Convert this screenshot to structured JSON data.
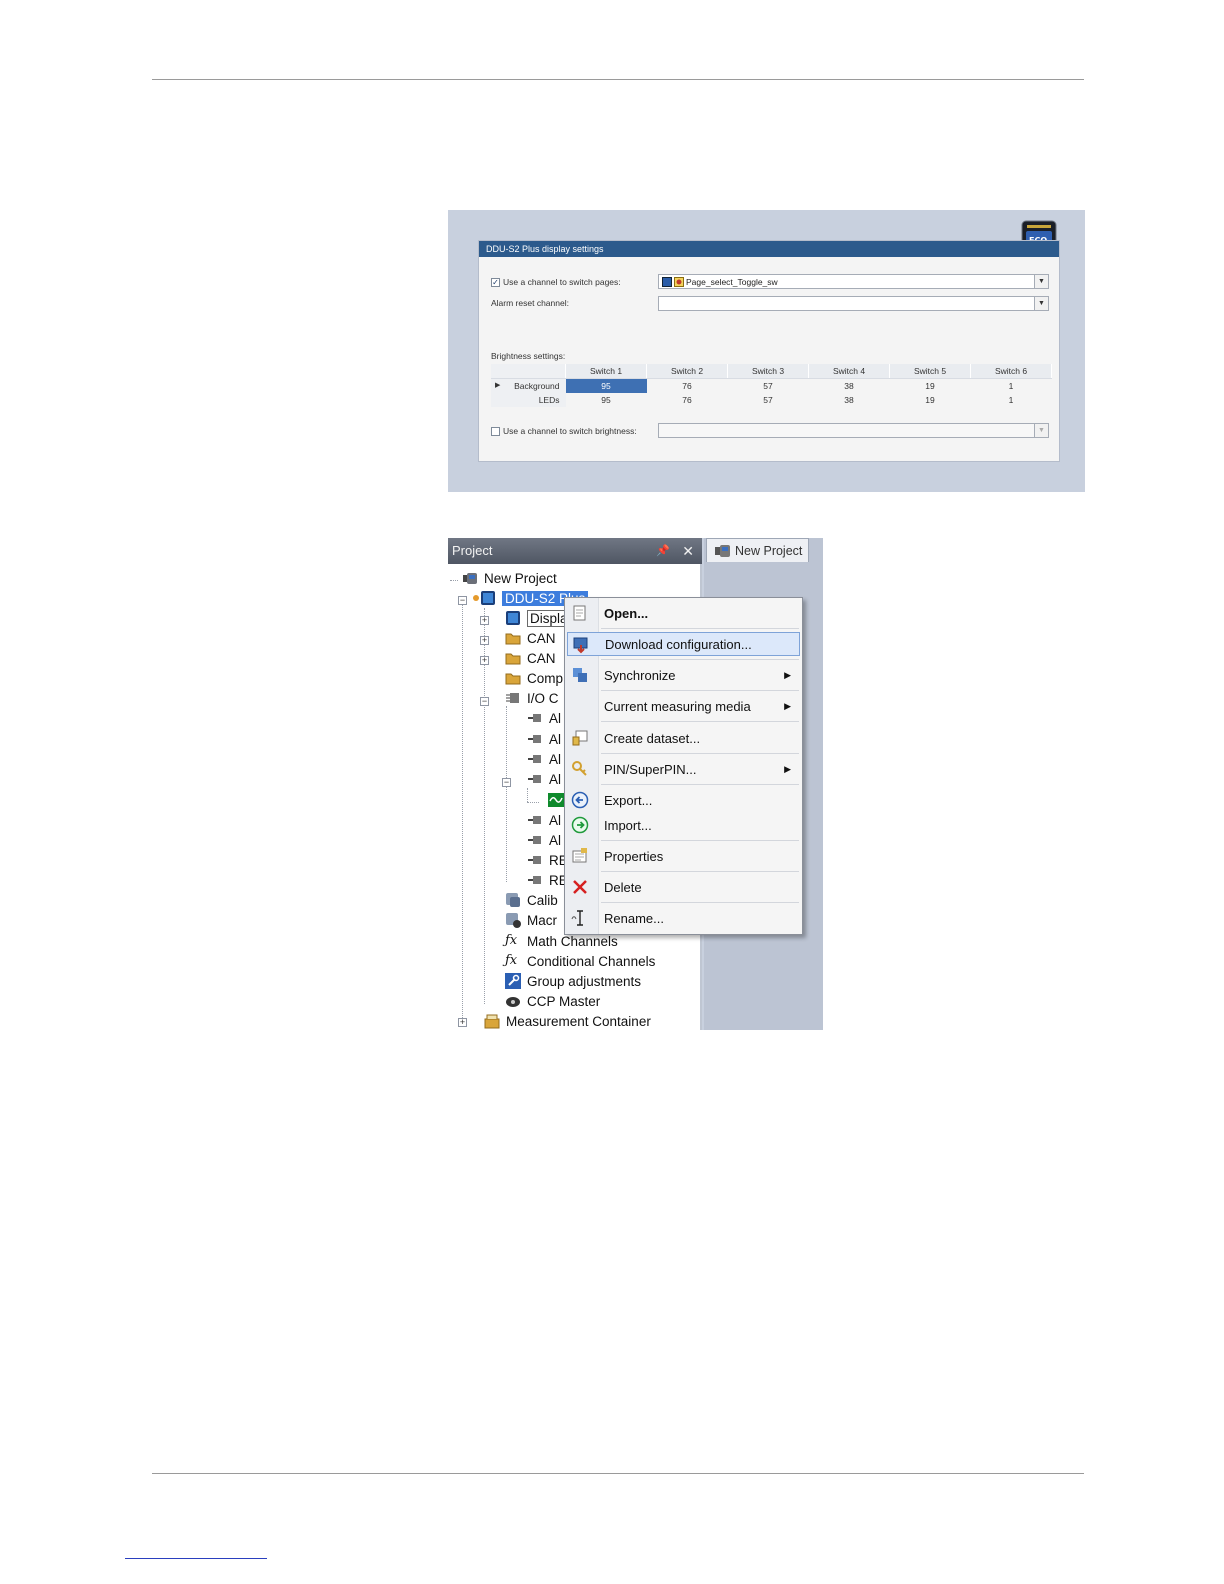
{
  "display_settings": {
    "panel_title": "DDU-S2 Plus display settings",
    "device_icon_text": "ECO",
    "switch_pages_label": "Use a channel to switch pages:",
    "switch_pages_checked": true,
    "switch_pages_value": "Page_select_Toggle_sw",
    "alarm_reset_label": "Alarm reset channel:",
    "alarm_reset_value": "",
    "brightness_label": "Brightness settings:",
    "columns": [
      "Switch 1",
      "Switch 2",
      "Switch 3",
      "Switch 4",
      "Switch 5",
      "Switch 6"
    ],
    "rows": [
      {
        "name": "Background",
        "values": [
          "95",
          "76",
          "57",
          "38",
          "19",
          "1"
        ]
      },
      {
        "name": "LEDs",
        "values": [
          "95",
          "76",
          "57",
          "38",
          "19",
          "1"
        ]
      }
    ],
    "switch_brightness_label": "Use a channel to switch brightness:",
    "switch_brightness_checked": false,
    "switch_brightness_value": ""
  },
  "project_panel": {
    "title": "Project",
    "tab_label": "New Project",
    "root": "New Project",
    "device": "DDU-S2 Plus",
    "items": {
      "display": "Displa",
      "can1": "CAN",
      "can2": "CAN",
      "comp": "Comp",
      "io": "I/O C",
      "a1": "Al",
      "a2": "Al",
      "a3": "Al",
      "a4": "Al",
      "a5": "Al",
      "a6": "Al",
      "r1": "RE",
      "r2": "RE",
      "calib": "Calib",
      "macro": "Macr",
      "math": "Math Channels",
      "cond": "Conditional Channels",
      "group": "Group adjustments",
      "ccp": "CCP Master",
      "measure": "Measurement Container"
    }
  },
  "context_menu": {
    "open": "Open...",
    "download": "Download configuration...",
    "synchronize": "Synchronize",
    "current_media": "Current measuring media",
    "create_dataset": "Create dataset...",
    "pin": "PIN/SuperPIN...",
    "export": "Export...",
    "import": "Import...",
    "properties": "Properties",
    "delete": "Delete",
    "rename": "Rename..."
  }
}
